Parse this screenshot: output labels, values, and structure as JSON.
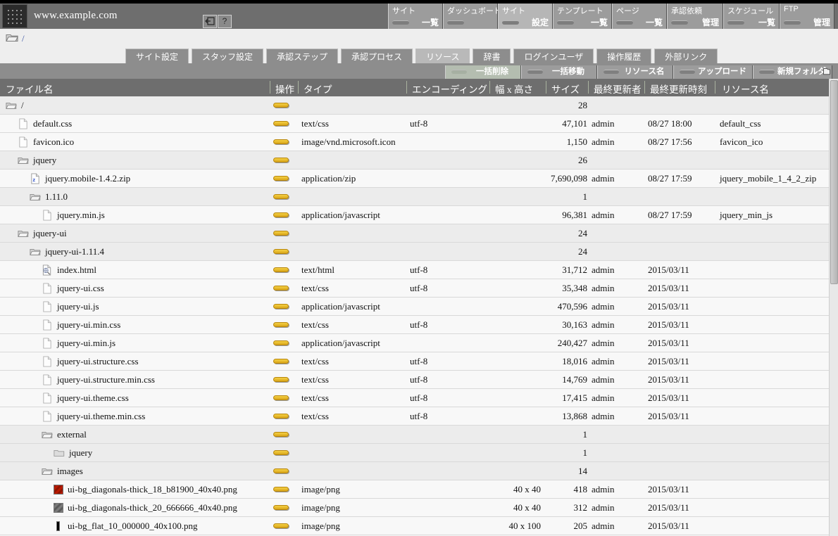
{
  "header": {
    "site_url": "www.example.com",
    "logout_icon": "logout-arrow-icon",
    "help_label": "?"
  },
  "topnav": [
    {
      "top": "サイト",
      "bottom": "一覧",
      "active": false
    },
    {
      "top": "ダッシュボード",
      "bottom": "",
      "active": false
    },
    {
      "top": "サイト",
      "bottom": "設定",
      "active": true
    },
    {
      "top": "テンプレート",
      "bottom": "一覧",
      "active": false
    },
    {
      "top": "ページ",
      "bottom": "一覧",
      "active": false
    },
    {
      "top": "承認依頼",
      "bottom": "管理",
      "active": false
    },
    {
      "top": "スケジュール",
      "bottom": "一覧",
      "active": false
    },
    {
      "top": "FTP",
      "bottom": "管理",
      "active": false
    }
  ],
  "breadcrumb": {
    "icon": "folder-icon",
    "path": "/"
  },
  "tabs": [
    {
      "label": "サイト設定",
      "selected": false
    },
    {
      "label": "スタッフ設定",
      "selected": false
    },
    {
      "label": "承認ステップ",
      "selected": false
    },
    {
      "label": "承認プロセス",
      "selected": false
    },
    {
      "label": "リソース",
      "selected": true
    },
    {
      "label": "辞書",
      "selected": false
    },
    {
      "label": "ログインユーザ",
      "selected": false
    },
    {
      "label": "操作履歴",
      "selected": false
    },
    {
      "label": "外部リンク",
      "selected": false
    }
  ],
  "actions": [
    {
      "label": "一括削除",
      "highlight": true,
      "corner_icon": ""
    },
    {
      "label": "一括移動",
      "highlight": false,
      "corner_icon": ""
    },
    {
      "label": "リソース名",
      "highlight": false,
      "corner_icon": ""
    },
    {
      "label": "アップロード",
      "highlight": false,
      "corner_icon": ""
    },
    {
      "label": "新規フォルダ",
      "highlight": false,
      "corner_icon": "new-folder-icon"
    }
  ],
  "table": {
    "columns": [
      "ファイル名",
      "操作",
      "タイプ",
      "エンコーディング",
      "幅 x 高さ",
      "サイズ",
      "最終更新者",
      "最終更新時刻",
      "リソース名"
    ],
    "rows": [
      {
        "name": "/",
        "indent": 0,
        "icon": "folder-open-icon",
        "kind": "dir",
        "type": "",
        "enc": "",
        "dim": "",
        "size": "28",
        "user": "",
        "date": "",
        "res": ""
      },
      {
        "name": "default.css",
        "indent": 1,
        "icon": "file-icon",
        "kind": "file",
        "type": "text/css",
        "enc": "utf-8",
        "dim": "",
        "size": "47,101",
        "user": "admin",
        "date": "08/27 18:00",
        "res": "default_css"
      },
      {
        "name": "favicon.ico",
        "indent": 1,
        "icon": "file-icon",
        "kind": "file",
        "type": "image/vnd.microsoft.icon",
        "enc": "",
        "dim": "",
        "size": "1,150",
        "user": "admin",
        "date": "08/27 17:56",
        "res": "favicon_ico"
      },
      {
        "name": "jquery",
        "indent": 1,
        "icon": "folder-open-icon",
        "kind": "dir",
        "type": "",
        "enc": "",
        "dim": "",
        "size": "26",
        "user": "",
        "date": "",
        "res": ""
      },
      {
        "name": "jquery.mobile-1.4.2.zip",
        "indent": 2,
        "icon": "zip-icon",
        "kind": "file",
        "type": "application/zip",
        "enc": "",
        "dim": "",
        "size": "7,690,098",
        "user": "admin",
        "date": "08/27 17:59",
        "res": "jquery_mobile_1_4_2_zip"
      },
      {
        "name": "1.11.0",
        "indent": 2,
        "icon": "folder-open-icon",
        "kind": "dir",
        "type": "",
        "enc": "",
        "dim": "",
        "size": "1",
        "user": "",
        "date": "",
        "res": ""
      },
      {
        "name": "jquery.min.js",
        "indent": 3,
        "icon": "file-icon",
        "kind": "file",
        "type": "application/javascript",
        "enc": "",
        "dim": "",
        "size": "96,381",
        "user": "admin",
        "date": "08/27 17:59",
        "res": "jquery_min_js"
      },
      {
        "name": "jquery-ui",
        "indent": 1,
        "icon": "folder-open-icon",
        "kind": "dir",
        "type": "",
        "enc": "",
        "dim": "",
        "size": "24",
        "user": "",
        "date": "",
        "res": ""
      },
      {
        "name": "jquery-ui-1.11.4",
        "indent": 2,
        "icon": "folder-open-icon",
        "kind": "dir",
        "type": "",
        "enc": "",
        "dim": "",
        "size": "24",
        "user": "",
        "date": "",
        "res": ""
      },
      {
        "name": "index.html",
        "indent": 3,
        "icon": "html-file-icon",
        "kind": "file",
        "type": "text/html",
        "enc": "utf-8",
        "dim": "",
        "size": "31,712",
        "user": "admin",
        "date": "2015/03/11",
        "res": ""
      },
      {
        "name": "jquery-ui.css",
        "indent": 3,
        "icon": "file-icon",
        "kind": "file",
        "type": "text/css",
        "enc": "utf-8",
        "dim": "",
        "size": "35,348",
        "user": "admin",
        "date": "2015/03/11",
        "res": ""
      },
      {
        "name": "jquery-ui.js",
        "indent": 3,
        "icon": "file-icon",
        "kind": "file",
        "type": "application/javascript",
        "enc": "",
        "dim": "",
        "size": "470,596",
        "user": "admin",
        "date": "2015/03/11",
        "res": ""
      },
      {
        "name": "jquery-ui.min.css",
        "indent": 3,
        "icon": "file-icon",
        "kind": "file",
        "type": "text/css",
        "enc": "utf-8",
        "dim": "",
        "size": "30,163",
        "user": "admin",
        "date": "2015/03/11",
        "res": ""
      },
      {
        "name": "jquery-ui.min.js",
        "indent": 3,
        "icon": "file-icon",
        "kind": "file",
        "type": "application/javascript",
        "enc": "",
        "dim": "",
        "size": "240,427",
        "user": "admin",
        "date": "2015/03/11",
        "res": ""
      },
      {
        "name": "jquery-ui.structure.css",
        "indent": 3,
        "icon": "file-icon",
        "kind": "file",
        "type": "text/css",
        "enc": "utf-8",
        "dim": "",
        "size": "18,016",
        "user": "admin",
        "date": "2015/03/11",
        "res": ""
      },
      {
        "name": "jquery-ui.structure.min.css",
        "indent": 3,
        "icon": "file-icon",
        "kind": "file",
        "type": "text/css",
        "enc": "utf-8",
        "dim": "",
        "size": "14,769",
        "user": "admin",
        "date": "2015/03/11",
        "res": ""
      },
      {
        "name": "jquery-ui.theme.css",
        "indent": 3,
        "icon": "file-icon",
        "kind": "file",
        "type": "text/css",
        "enc": "utf-8",
        "dim": "",
        "size": "17,415",
        "user": "admin",
        "date": "2015/03/11",
        "res": ""
      },
      {
        "name": "jquery-ui.theme.min.css",
        "indent": 3,
        "icon": "file-icon",
        "kind": "file",
        "type": "text/css",
        "enc": "utf-8",
        "dim": "",
        "size": "13,868",
        "user": "admin",
        "date": "2015/03/11",
        "res": ""
      },
      {
        "name": "external",
        "indent": 3,
        "icon": "folder-open-icon",
        "kind": "dir",
        "type": "",
        "enc": "",
        "dim": "",
        "size": "1",
        "user": "",
        "date": "",
        "res": ""
      },
      {
        "name": "jquery",
        "indent": 4,
        "icon": "folder-closed-icon",
        "kind": "dir",
        "type": "",
        "enc": "",
        "dim": "",
        "size": "1",
        "user": "",
        "date": "",
        "res": ""
      },
      {
        "name": "images",
        "indent": 3,
        "icon": "folder-open-icon",
        "kind": "dir",
        "type": "",
        "enc": "",
        "dim": "",
        "size": "14",
        "user": "",
        "date": "",
        "res": ""
      },
      {
        "name": "ui-bg_diagonals-thick_18_b81900_40x40.png",
        "indent": 4,
        "icon": "swatch-red",
        "kind": "file",
        "type": "image/png",
        "enc": "",
        "dim": "40 x 40",
        "size": "418",
        "user": "admin",
        "date": "2015/03/11",
        "res": ""
      },
      {
        "name": "ui-bg_diagonals-thick_20_666666_40x40.png",
        "indent": 4,
        "icon": "swatch-gray",
        "kind": "file",
        "type": "image/png",
        "enc": "",
        "dim": "40 x 40",
        "size": "312",
        "user": "admin",
        "date": "2015/03/11",
        "res": ""
      },
      {
        "name": "ui-bg_flat_10_000000_40x100.png",
        "indent": 4,
        "icon": "swatch-black",
        "kind": "file",
        "type": "image/png",
        "enc": "",
        "dim": "40 x 100",
        "size": "205",
        "user": "admin",
        "date": "2015/03/11",
        "res": ""
      }
    ]
  }
}
